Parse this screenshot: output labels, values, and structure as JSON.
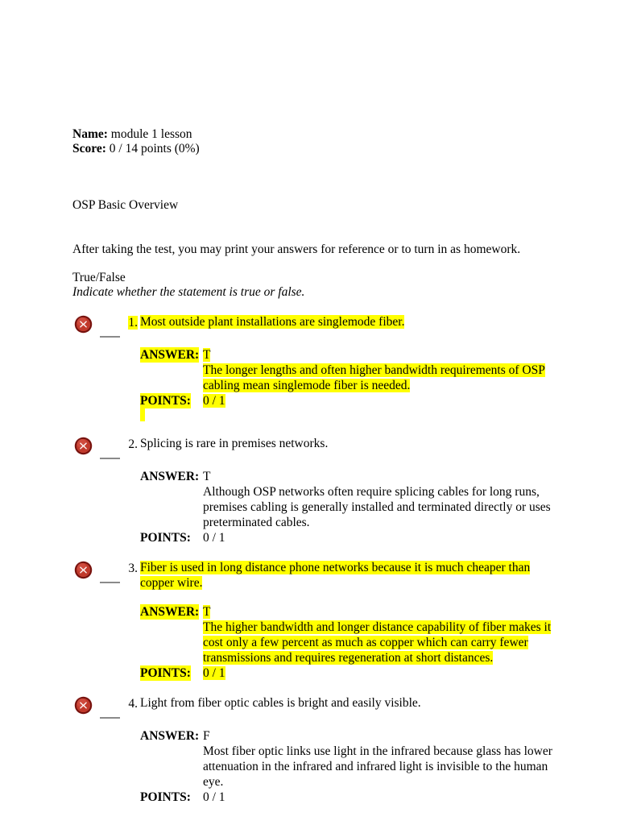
{
  "document": {
    "header": {
      "name_label": "Name:",
      "name_value": " module 1 lesson",
      "score_label": "Score:",
      "score_value": " 0 / 14 points (0%)"
    },
    "title": "OSP Basic Overview",
    "intro": "After taking the test, you may print your answers for reference or to turn in as homework.",
    "section_type": "True/False",
    "section_instruction": "Indicate whether the statement is true or false.",
    "labels": {
      "answer": "ANSWER:",
      "points": "POINTS:"
    },
    "status_icon": "incorrect-x-icon",
    "highlight_color": "#ffff00",
    "icon_color": "#c0392b"
  },
  "questions": [
    {
      "number": "1.",
      "number_highlighted": true,
      "text": "Most outside plant installations are singlemode fiber.",
      "text_highlighted": true,
      "answer": "T",
      "answer_highlighted": true,
      "answer_label_highlighted": true,
      "explanation": "The longer lengths and often higher bandwidth requirements of OSP cabling mean singlemode fiber is needed.",
      "explanation_highlighted": true,
      "points": "0 / 1",
      "points_highlighted": true,
      "points_label_highlighted": true,
      "trailing_highlight": true
    },
    {
      "number": "2.",
      "number_highlighted": false,
      "text": "Splicing is rare in premises networks.",
      "text_highlighted": false,
      "answer": "T",
      "answer_highlighted": false,
      "answer_label_highlighted": false,
      "explanation": "Although OSP networks often require splicing cables for long runs, premises cabling is generally installed and terminated directly or uses preterminated cables.",
      "explanation_highlighted": false,
      "points": "0 / 1",
      "points_highlighted": false,
      "points_label_highlighted": false,
      "trailing_highlight": false
    },
    {
      "number": "3.",
      "number_highlighted": false,
      "text": "Fiber is used in long distance phone networks because it is much cheaper than copper wire.",
      "text_highlighted": true,
      "answer": "T",
      "answer_highlighted": true,
      "answer_label_highlighted": true,
      "explanation": "The higher bandwidth  and longer distance capability of fiber makes it cost only a few percent as much as copper which can carry fewer transmissions and requires regeneration at short distances.",
      "explanation_highlighted": true,
      "points": "0 / 1",
      "points_highlighted": true,
      "points_label_highlighted": true,
      "trailing_highlight": false
    },
    {
      "number": "4.",
      "number_highlighted": false,
      "text": "Light from fiber optic cables is bright and easily visible.",
      "text_highlighted": false,
      "answer": "F",
      "answer_highlighted": false,
      "answer_label_highlighted": false,
      "explanation": "Most fiber optic links use light in the infrared because glass has lower attenuation in the infrared and infrared light is invisible to the human eye.",
      "explanation_highlighted": false,
      "points": "0 / 1",
      "points_highlighted": false,
      "points_label_highlighted": false,
      "trailing_highlight": false
    }
  ]
}
